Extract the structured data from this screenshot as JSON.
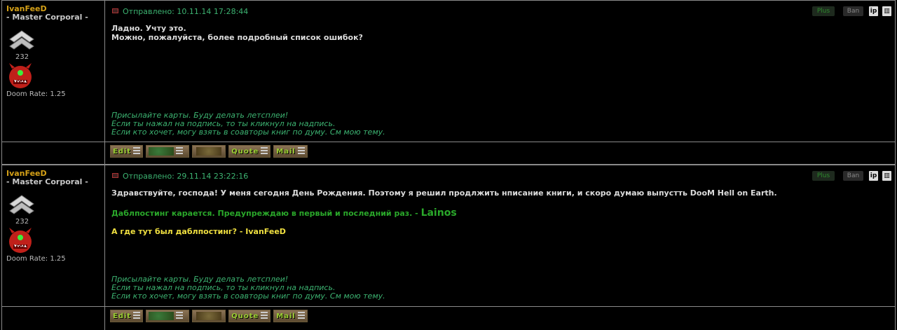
{
  "posts": [
    {
      "username": "IvanFeeD",
      "rank": "- Master Corporal -",
      "post_count": "232",
      "doom_rate": "Doom Rate: 1.25",
      "sent": "Отправлено: 10.11.14 17:28:44",
      "plus": "Plus",
      "ban": "Ban",
      "body_line1": "Ладно. Учту это.",
      "body_line2": "Можно, пожалуйста, более подробный список ошибок?",
      "sig1": "Присылайте карты. Буду делать летсплеи!",
      "sig2": "Если ты нажал на подпись, то ты кликнул на надпись.",
      "sig3": "Если кто хочет, могу взять в соавторы книг по думу. См мою тему.",
      "buttons": {
        "edit": "Edit",
        "quote": "Quote",
        "mail": "Mail"
      }
    },
    {
      "username": "IvanFeeD",
      "rank": "- Master Corporal -",
      "post_count": "232",
      "doom_rate": "Doom Rate: 1.25",
      "sent": "Отправлено: 29.11.14 23:22:16",
      "plus": "Plus",
      "ban": "Ban",
      "body_line1": "Здравствуйте, господа! У меня сегодня День Рождения. Поэтому я решил продлжить нписание книги, и скоро думаю выпустть DooM Hell on Earth.",
      "mod_text": "Даблпостинг карается. Предупреждаю в первый и последний раз. -",
      "mod_name": "Lainos",
      "reply_text": "А где тут был даблпостинг? - IvanFeeD",
      "sig1": "Присылайте карты. Буду делать летсплеи!",
      "sig2": "Если ты нажал на подпись, то ты кликнул на надпись.",
      "sig3": "Если кто хочет, могу взять в соавторы книг по думу. См мою тему.",
      "buttons": {
        "edit": "Edit",
        "quote": "Quote",
        "mail": "Mail"
      }
    }
  ],
  "icons": {
    "rank": "rank-chevron-icon",
    "avatar": "cacodemon-avatar",
    "ip": "ip-icon",
    "delete": "trash-icon"
  },
  "colors": {
    "username": "#d4a017",
    "date": "#3cb371",
    "moderator": "#2aa82a",
    "reply": "#f0e040",
    "border": "#8a8a8a"
  }
}
